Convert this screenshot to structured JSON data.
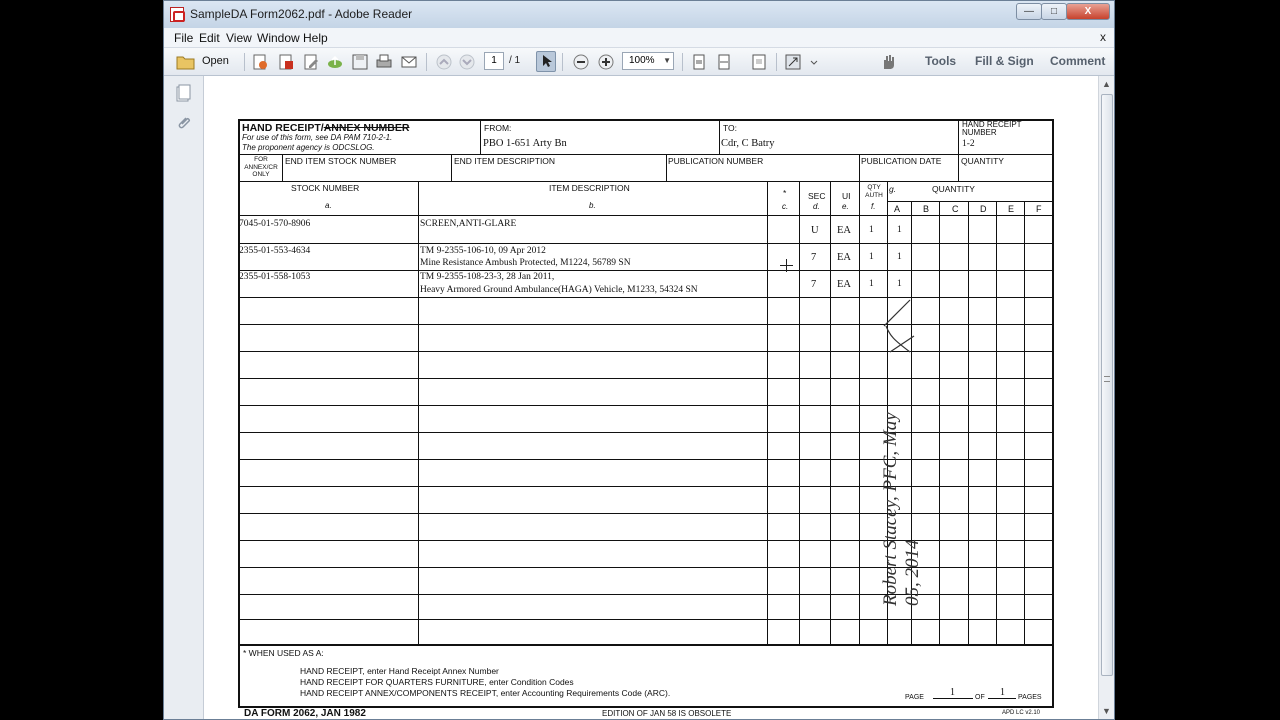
{
  "window": {
    "title": "SampleDA Form2062.pdf - Adobe Reader",
    "controls": {
      "min": "—",
      "max": "□",
      "close": "X"
    }
  },
  "menu": {
    "items": [
      "File",
      "Edit",
      "View",
      "Window",
      "Help"
    ],
    "close_doc": "x"
  },
  "toolbar": {
    "open_label": "Open",
    "page_current": "1",
    "page_total": "/ 1",
    "zoom": "100%",
    "tools_label": "Tools",
    "fill_sign_label": "Fill & Sign",
    "comment_label": "Comment"
  },
  "form": {
    "title_prefix": "HAND RECEIPT/",
    "title_struck": "ANNEX NUMBER",
    "use_note": "For use of this form, see DA PAM 710-2-1.",
    "agency_note": "The proponent agency is ODCSLOG.",
    "from_label": "FROM:",
    "from_value": "PBO 1-651 Arty Bn",
    "to_label": "TO:",
    "to_value": "Cdr, C Batry",
    "hr_number_label": "HAND RECEIPT NUMBER",
    "hr_number_value": "1-2",
    "for_annex_label": "FOR ANNEX/CR ONLY",
    "end_item_stock_label": "END ITEM STOCK NUMBER",
    "end_item_desc_label": "END ITEM DESCRIPTION",
    "publication_number_label": "PUBLICATION NUMBER",
    "publication_date_label": "PUBLICATION DATE",
    "quantity_label": "QUANTITY",
    "col_stock": "STOCK NUMBER",
    "col_stock_sub": "a.",
    "col_desc": "ITEM DESCRIPTION",
    "col_desc_sub": "b.",
    "col_star": "*",
    "col_star_sub": "c.",
    "col_sec": "SEC",
    "col_sec_sub": "d.",
    "col_ui": "UI",
    "col_ui_sub": "e.",
    "col_qty_auth": "QTY AUTH",
    "col_qty_auth_sub": "f.",
    "col_g": "g.",
    "col_quantity": "QUANTITY",
    "qty_letters": [
      "A",
      "B",
      "C",
      "D",
      "E",
      "F"
    ],
    "rows": [
      {
        "stock": "7045-01-570-8906",
        "desc1": "SCREEN,ANTI-GLARE",
        "desc2": "",
        "sec": "U",
        "ui": "EA",
        "auth": "1",
        "qa": "1"
      },
      {
        "stock": "2355-01-553-4634",
        "desc1": "TM 9-2355-106-10, 09 Apr 2012",
        "desc2": "Mine Resistance Ambush Protected, M1224, 56789 SN",
        "sec": "7",
        "ui": "EA",
        "auth": "1",
        "qa": "1"
      },
      {
        "stock": "2355-01-558-1053",
        "desc1": "TM 9-2355-108-23-3, 28 Jan 2011,",
        "desc2": "Heavy Armored Ground Ambulance(HAGA) Vehicle, M1233, 54324 SN",
        "sec": "7",
        "ui": "EA",
        "auth": "1",
        "qa": "1"
      }
    ],
    "footnote_title": "*  WHEN USED AS A:",
    "footnote_lines": [
      "HAND RECEIPT, enter Hand Receipt Annex Number",
      "HAND RECEIPT FOR QUARTERS FURNITURE, enter Condition Codes",
      "HAND RECEIPT ANNEX/COMPONENTS RECEIPT, enter Accounting Requirements Code (ARC)."
    ],
    "page_label": "PAGE",
    "page_value": "1",
    "of_label": "OF",
    "of_value": "1",
    "pages_label": "PAGES",
    "form_id": "DA FORM 2062, JAN 1982",
    "edition_note": "EDITION OF JAN 58 IS OBSOLETE",
    "apd_note": "APD LC v2.10",
    "signature": "Robert Stacey, PFC, May 05, 2014"
  }
}
